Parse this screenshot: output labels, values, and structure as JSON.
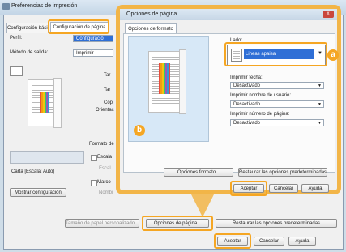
{
  "main_window": {
    "title": "Preferencias de impresión",
    "tabs": [
      {
        "label": "Configuración básica"
      },
      {
        "label": "Configuración de página"
      }
    ],
    "perfil_label": "Perfil:",
    "perfil_value": "Configuració",
    "metodo_label": "Método de salida:",
    "metodo_value": "Imprimir",
    "ta_items": [
      "Tar",
      "Tar",
      "Cop"
    ],
    "orientacion_label": "Orientac",
    "formato_label": "Formato de",
    "escala_label": "Escala",
    "escala_value": "Escal",
    "marco_label": "Marco",
    "nombre_label": "Nombr",
    "preview_caption": "Carta [Escala: Auto]",
    "mostrar_button": "Mostrar configuración",
    "tamano_button": "Tamaño de papel personalizado...",
    "opciones_pagina_button": "Opciones de página...",
    "restaurar_button": "Restaurar las opciones predeterminadas",
    "aceptar": "Aceptar",
    "cancelar": "Cancelar",
    "ayuda": "Ayuda"
  },
  "dialog": {
    "title": "Opciones de página",
    "close": "x",
    "tab": "Opciones de formato",
    "lado_label": "Lado:",
    "lado_value": "Lineas apaisa",
    "imprimir_fecha_label": "Imprimir fecha:",
    "imprimir_fecha_value": "Desactivado",
    "imprimir_nombre_label": "Imprimir nombre de usuario:",
    "imprimir_nombre_value": "Desactivado",
    "imprimir_numero_label": "Imprimir número de página:",
    "imprimir_numero_value": "Desactivado",
    "opciones_formato_button": "Opciones formato...",
    "restaurar_button": "Restaurar las opciones predeterminadas",
    "aceptar": "Aceptar",
    "cancelar": "Cancelar",
    "ayuda": "Ayuda"
  },
  "callouts": {
    "a": "a",
    "b": "b"
  },
  "colors": {
    "highlight": "#f5a623",
    "selection": "#2f6fd6"
  }
}
